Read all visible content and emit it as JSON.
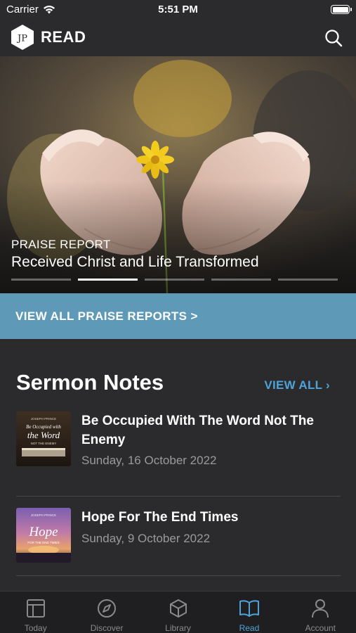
{
  "status_bar": {
    "carrier": "Carrier",
    "time": "5:51 PM",
    "battery_level": 1.0
  },
  "header": {
    "logo_text": "JP",
    "title": "READ",
    "search_icon": "search-icon"
  },
  "hero": {
    "category": "PRAISE REPORT",
    "title": "Received Christ and Life Transformed",
    "slide_count": 5,
    "active_slide": 2
  },
  "praise_link": {
    "label": "VIEW ALL PRAISE REPORTS >"
  },
  "sermon_notes": {
    "title": "Sermon Notes",
    "view_all": "VIEW ALL ›",
    "items": [
      {
        "title": "Be Occupied With The Word Not The Enemy",
        "date": "Sunday, 16 October 2022",
        "thumb_text": [
          "JOSEPH PRINCE",
          "Be Occupied with",
          "the Word",
          "NOT THE ENEMY"
        ]
      },
      {
        "title": "Hope For The End Times",
        "date": "Sunday, 9 October 2022",
        "thumb_text": [
          "JOSEPH PRINCE",
          "Hope",
          "FOR THE END TIMES"
        ]
      }
    ]
  },
  "tabs": [
    {
      "label": "Today",
      "icon": "today-icon",
      "active": false
    },
    {
      "label": "Discover",
      "icon": "compass-icon",
      "active": false
    },
    {
      "label": "Library",
      "icon": "cube-icon",
      "active": false
    },
    {
      "label": "Read",
      "icon": "book-icon",
      "active": true
    },
    {
      "label": "Account",
      "icon": "person-icon",
      "active": false
    }
  ],
  "colors": {
    "background": "#2b2b2d",
    "accent": "#4fa3d9",
    "banner": "#5e9ab8",
    "tab_bar": "#1f1f21"
  }
}
